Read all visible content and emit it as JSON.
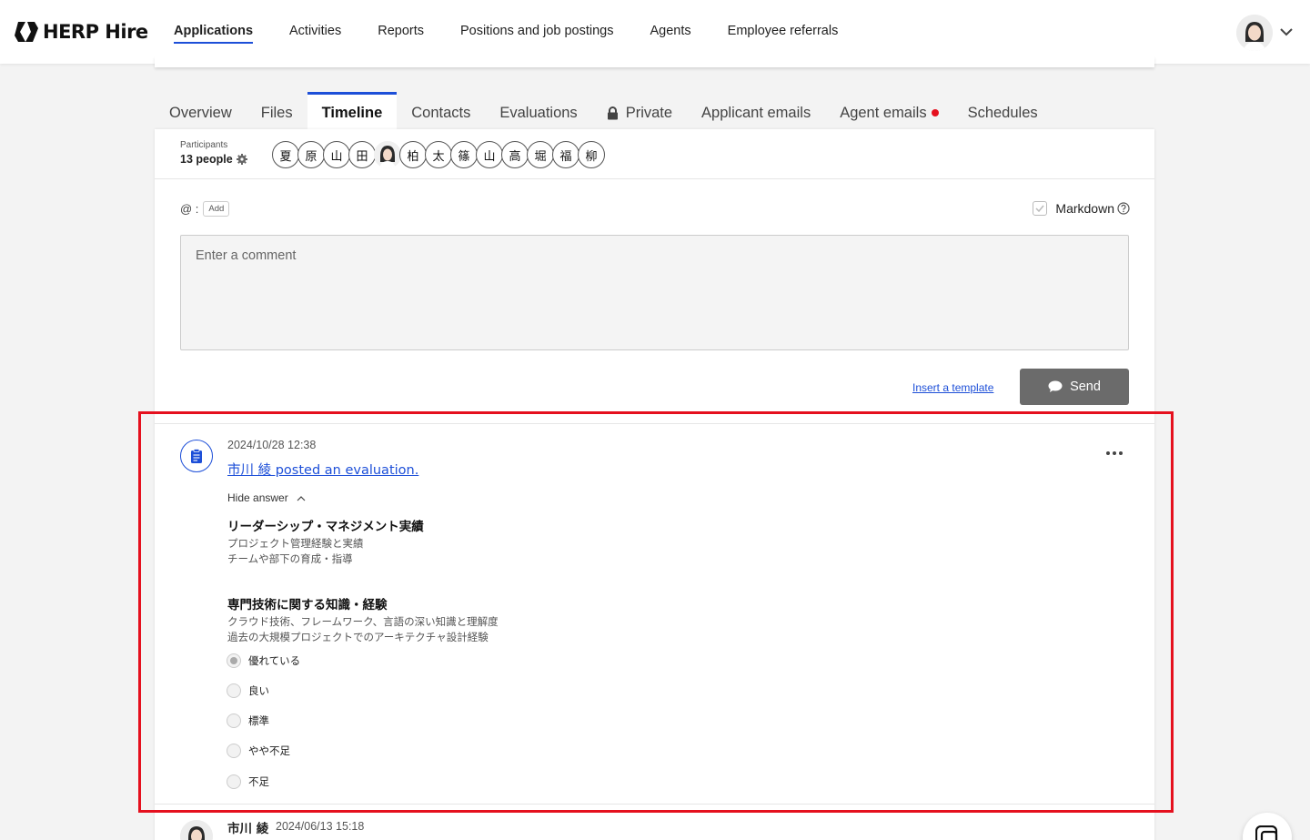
{
  "brand": {
    "name": "HERP Hire"
  },
  "nav": {
    "items": [
      {
        "label": "Applications",
        "active": true
      },
      {
        "label": "Activities"
      },
      {
        "label": "Reports"
      },
      {
        "label": "Positions and job postings"
      },
      {
        "label": "Agents"
      },
      {
        "label": "Employee referrals"
      }
    ]
  },
  "tabs": [
    {
      "label": "Overview"
    },
    {
      "label": "Files"
    },
    {
      "label": "Timeline",
      "active": true
    },
    {
      "label": "Contacts"
    },
    {
      "label": "Evaluations"
    },
    {
      "label": "Private",
      "icon": "lock-icon"
    },
    {
      "label": "Applicant emails"
    },
    {
      "label": "Agent emails",
      "badge": "red-dot"
    },
    {
      "label": "Schedules"
    }
  ],
  "participants": {
    "label": "Participants",
    "count": "13 people",
    "chips": [
      "夏",
      "原",
      "山",
      "田",
      "photo",
      "柏",
      "太",
      "篠",
      "山",
      "高",
      "堀",
      "福",
      "柳"
    ]
  },
  "composer": {
    "mention_prefix": "@ :",
    "add_label": "Add",
    "markdown_label": "Markdown",
    "placeholder": "Enter a comment",
    "template_link": "Insert a template",
    "send_label": "Send"
  },
  "evaluation": {
    "date": "2024/10/28 12:38",
    "title": "市川 綾 posted an evaluation.",
    "hide_answer": "Hide answer",
    "questions": [
      {
        "title": "リーダーシップ・マネジメント実績",
        "desc": [
          "プロジェクト管理経験と実績",
          "チームや部下の育成・指導"
        ]
      },
      {
        "title": "専門技術に関する知識・経験",
        "desc": [
          "クラウド技術、フレームワーク、言語の深い知識と理解度",
          "過去の大規模プロジェクトでのアーキテクチャ設計経験"
        ]
      }
    ],
    "options": [
      "優れている",
      "良い",
      "標準",
      "やや不足",
      "不足"
    ],
    "selected_option": "優れている"
  },
  "next_entry": {
    "name": "市川 綾",
    "date": "2024/06/13 15:18"
  },
  "colors": {
    "accent": "#1d4fd8",
    "highlight": "#e5101e",
    "send_button": "#6b6b6b"
  }
}
